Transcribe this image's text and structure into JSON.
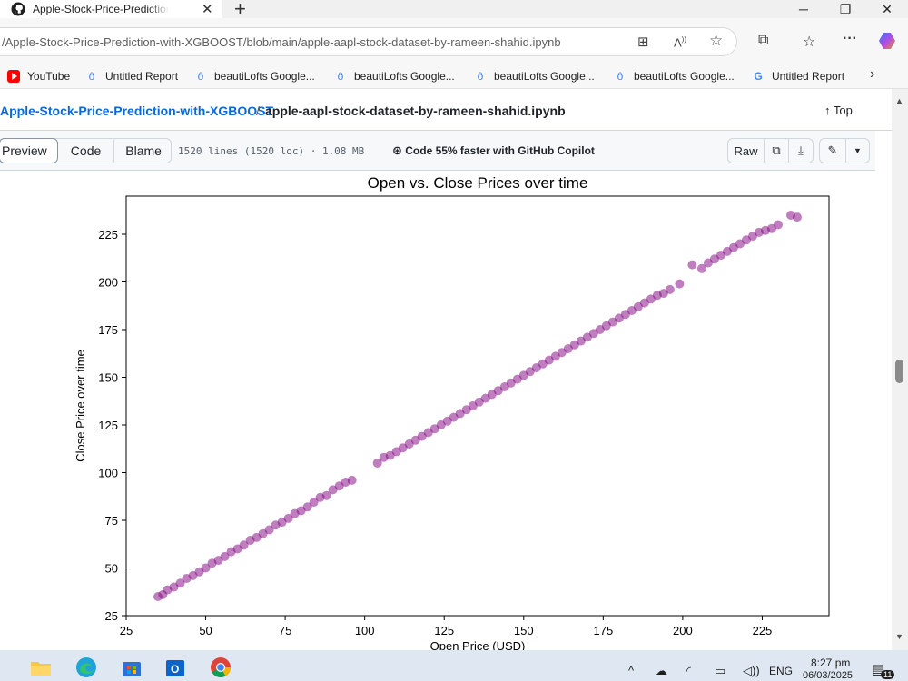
{
  "browser": {
    "tab_title": "Apple-Stock-Price-Prediction-with-XGBOOST",
    "url": "/Apple-Stock-Price-Prediction-with-XGBOOST/blob/main/apple-aapl-stock-dataset-by-rameen-shahid.ipynb",
    "favorites": [
      {
        "label": "YouTube",
        "icon": "youtube-icon"
      },
      {
        "label": "Untitled Report",
        "icon": "report-icon"
      },
      {
        "label": "beautiLofts Google...",
        "icon": "report-icon"
      },
      {
        "label": "beautiLofts Google...",
        "icon": "report-icon"
      },
      {
        "label": "beautiLofts Google...",
        "icon": "report-icon"
      },
      {
        "label": "beautiLofts Google...",
        "icon": "report-icon"
      },
      {
        "label": "Untitled Report",
        "icon": "google-icon"
      }
    ]
  },
  "github": {
    "repo_link": "Apple-Stock-Price-Prediction-with-XGBOOST",
    "separator": "/",
    "file_name": "apple-aapl-stock-dataset-by-rameen-shahid.ipynb",
    "top_label": "Top",
    "view_tabs": [
      "Preview",
      "Code",
      "Blame"
    ],
    "active_view": "Preview",
    "file_meta": "1520 lines (1520 loc) · 1.08 MB",
    "copilot_text": "Code 55% faster with GitHub Copilot",
    "raw_label": "Raw"
  },
  "taskbar": {
    "language": "ENG",
    "time": "8:27 pm",
    "date": "06/03/2025",
    "notification_count": "11"
  },
  "chart_data": {
    "type": "scatter",
    "title": "Open vs. Close Prices over time",
    "xlabel": "Open Price (USD)",
    "ylabel": "Close Price over time",
    "xlim": [
      25,
      246
    ],
    "ylim": [
      25,
      245
    ],
    "xticks": [
      25,
      50,
      75,
      100,
      125,
      150,
      175,
      200,
      225
    ],
    "yticks": [
      25,
      50,
      75,
      100,
      125,
      150,
      175,
      200,
      225
    ],
    "color": "#800080",
    "alpha": 0.5,
    "grid": false,
    "x": [
      35,
      36.5,
      38,
      40,
      42,
      44,
      46,
      48,
      50,
      52,
      54,
      56,
      58,
      60,
      62,
      64,
      66,
      68,
      70,
      72,
      74,
      76,
      78,
      80,
      82,
      84,
      86,
      88,
      90,
      92,
      94,
      96,
      104,
      106,
      108,
      110,
      112,
      114,
      116,
      118,
      120,
      122,
      124,
      126,
      128,
      130,
      132,
      134,
      136,
      138,
      140,
      142,
      144,
      146,
      148,
      150,
      152,
      154,
      156,
      158,
      160,
      162,
      164,
      166,
      168,
      170,
      172,
      174,
      176,
      178,
      180,
      182,
      184,
      186,
      188,
      190,
      192,
      194,
      196,
      199,
      203,
      206,
      208,
      210,
      212,
      214,
      216,
      218,
      220,
      222,
      224,
      226,
      228,
      230,
      234,
      236
    ],
    "y": [
      35,
      36,
      38.5,
      40,
      42,
      44.5,
      46,
      48,
      50,
      52.5,
      54,
      56,
      58.5,
      60,
      62,
      64.5,
      66,
      68,
      70,
      72.5,
      74,
      76,
      78.5,
      80,
      82,
      84.5,
      87,
      88,
      91,
      93,
      95,
      96,
      105,
      108,
      109,
      111,
      113,
      115,
      117,
      119,
      121,
      123,
      125,
      127,
      129,
      131,
      133,
      135,
      137,
      139,
      141,
      143,
      145,
      147,
      149,
      151,
      153,
      155,
      157,
      159,
      161,
      163,
      165,
      167,
      169,
      171,
      173,
      175,
      177,
      179,
      181,
      183,
      185,
      187,
      189,
      191,
      193,
      194,
      196,
      199,
      209,
      207,
      210,
      212,
      214,
      216,
      218,
      220,
      222,
      224,
      226,
      227,
      228,
      230,
      235,
      234
    ]
  }
}
